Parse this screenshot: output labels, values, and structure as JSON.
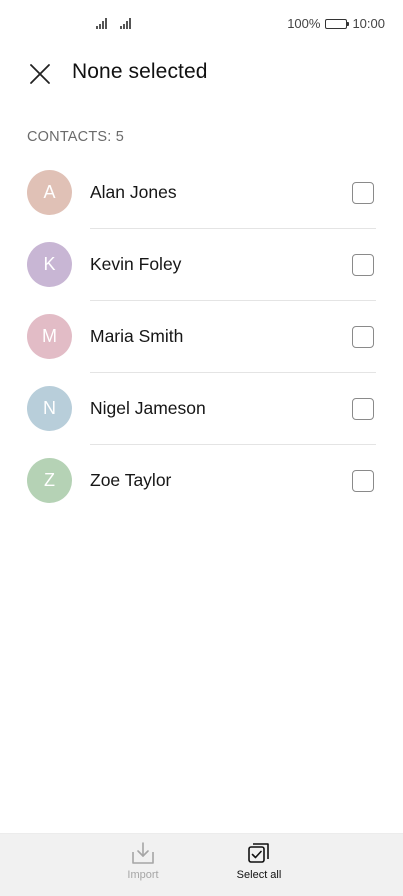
{
  "status_bar": {
    "battery_text": "100%",
    "time": "10:00"
  },
  "header": {
    "title": "None selected",
    "close_icon": "close-icon"
  },
  "section": {
    "label": "CONTACTS: 5"
  },
  "contacts": [
    {
      "initial": "A",
      "name": "Alan Jones",
      "avatar_color": "#e0c1b6",
      "checked": false
    },
    {
      "initial": "K",
      "name": "Kevin Foley",
      "avatar_color": "#c8b6d4",
      "checked": false
    },
    {
      "initial": "M",
      "name": "Maria Smith",
      "avatar_color": "#e2bcc6",
      "checked": false
    },
    {
      "initial": "N",
      "name": "Nigel Jameson",
      "avatar_color": "#b8ceda",
      "checked": false
    },
    {
      "initial": "Z",
      "name": "Zoe Taylor",
      "avatar_color": "#b5d2b5",
      "checked": false
    }
  ],
  "toolbar": {
    "import_label": "Import",
    "import_icon": "import-icon",
    "select_all_label": "Select all",
    "select_all_icon": "select-all-icon"
  }
}
